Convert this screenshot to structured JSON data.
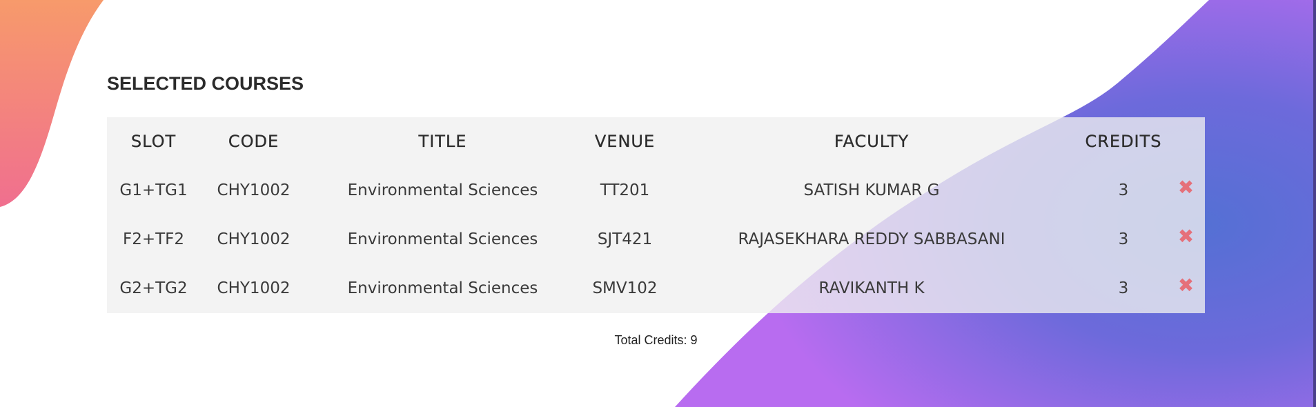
{
  "section": {
    "title": "SELECTED COURSES"
  },
  "table": {
    "headers": {
      "slot": "SLOT",
      "code": "CODE",
      "title": "TITLE",
      "venue": "VENUE",
      "faculty": "FACULTY",
      "credits": "CREDITS"
    },
    "rows": [
      {
        "slot": "G1+TG1",
        "code": "CHY1002",
        "title": "Environmental Sciences",
        "venue": "TT201",
        "faculty": "SATISH KUMAR G",
        "credits": "3"
      },
      {
        "slot": "F2+TF2",
        "code": "CHY1002",
        "title": "Environmental Sciences",
        "venue": "SJT421",
        "faculty": "RAJASEKHARA REDDY SABBASANI",
        "credits": "3"
      },
      {
        "slot": "G2+TG2",
        "code": "CHY1002",
        "title": "Environmental Sciences",
        "venue": "SMV102",
        "faculty": "RAVIKANTH K",
        "credits": "3"
      }
    ],
    "remove_icon": "remove-x-icon",
    "remove_glyph": "✖"
  },
  "total": {
    "text": "Total Credits: 9"
  },
  "colors": {
    "remove": "#e5707a",
    "blob_orange": "#f79a6b",
    "blob_pink": "#f06f8f",
    "wave_purple": "#b56cf0",
    "wave_blue": "#5a6fd6"
  }
}
